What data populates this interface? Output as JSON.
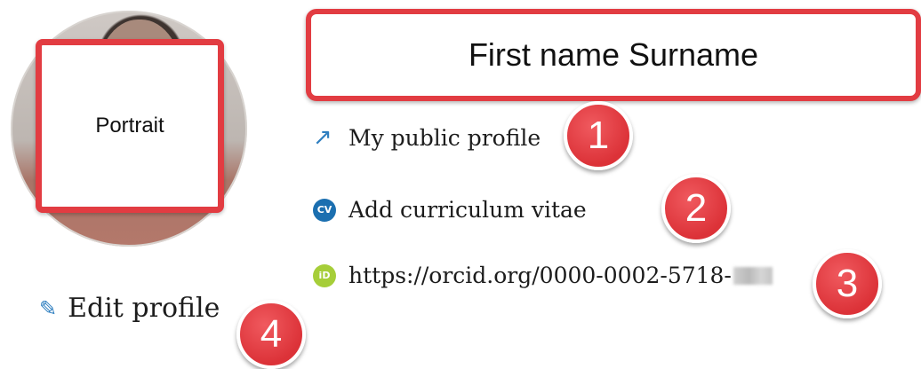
{
  "profile": {
    "name": "First name Surname",
    "portrait_label": "Portrait",
    "links": {
      "public_profile": "My public profile",
      "add_cv": "Add curriculum vitae",
      "orcid": "https://orcid.org/0000-0002-5718-"
    },
    "edit_label": "Edit profile"
  },
  "icons": {
    "public_profile": "external-link-arrow-icon",
    "cv": "cv-icon",
    "cv_text": "CV",
    "orcid": "orcid-icon",
    "orcid_text": "iD",
    "edit": "pencil-icon"
  },
  "callouts": [
    "1",
    "2",
    "3",
    "4"
  ],
  "colors": {
    "highlight": "#e23c42",
    "link_icon": "#2f7fc0",
    "cv_icon": "#1b6fb0",
    "orcid_icon": "#a6ce39"
  }
}
